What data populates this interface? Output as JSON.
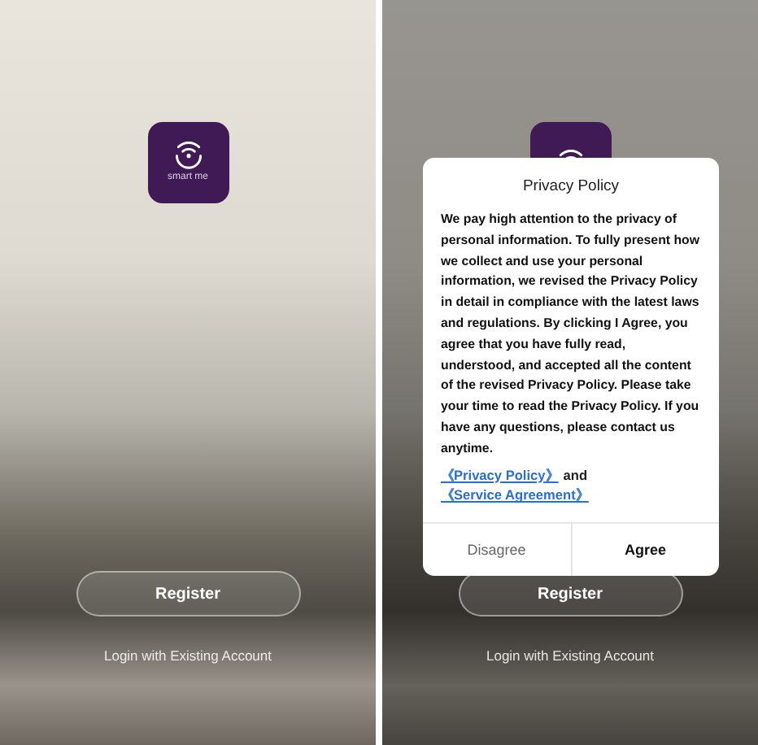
{
  "screens": [
    {
      "logo": {
        "caption": "smart me"
      },
      "register_button": "Register",
      "login_link": "Login with Existing Account",
      "dimmed": false
    },
    {
      "register_button": "Register",
      "login_link": "Login with Existing Account",
      "dimmed": true,
      "dialog": {
        "title": "Privacy Policy",
        "body": "We pay high attention to the privacy of personal information. To fully present how we collect and use your personal information, we revised the Privacy Policy in detail in compliance with the latest laws and regulations. By clicking I Agree, you agree that you have fully read, understood, and accepted all the content of the revised Privacy Policy. Please take your time to read the Privacy Policy. If you have any questions, please contact us anytime.",
        "link_1": "《Privacy Policy》",
        "joiner": "and",
        "link_2": "《Service Agreement》",
        "buttons": [
          {
            "label": "Disagree",
            "kind": "secondary"
          },
          {
            "label": "Agree",
            "kind": "primary"
          }
        ]
      }
    }
  ]
}
